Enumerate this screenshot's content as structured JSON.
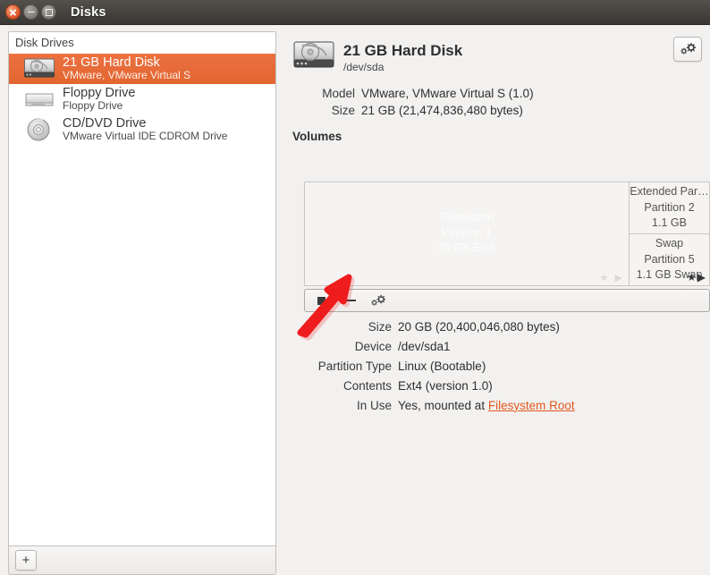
{
  "window": {
    "title": "Disks",
    "buttons": {
      "close": "close",
      "minimize": "minimize",
      "maximize": "maximize"
    }
  },
  "sidebar": {
    "header": "Disk Drives",
    "add_button_label": "+",
    "items": [
      {
        "icon": "hard-disk-icon",
        "title": "21 GB Hard Disk",
        "subtitle": "VMware, VMware Virtual S",
        "selected": true
      },
      {
        "icon": "floppy-drive-icon",
        "title": "Floppy Drive",
        "subtitle": "Floppy Drive",
        "selected": false
      },
      {
        "icon": "cdrom-drive-icon",
        "title": "CD/DVD Drive",
        "subtitle": "VMware Virtual IDE CDROM Drive",
        "selected": false
      }
    ]
  },
  "detail": {
    "disk_icon": "hard-disk-icon",
    "disk_name": "21 GB Hard Disk",
    "device_path": "/dev/sda",
    "gear_button": "gear-icon",
    "info": [
      {
        "key": "Model",
        "value": "VMware, VMware Virtual S (1.0)"
      },
      {
        "key": "Size",
        "value": "21 GB (21,474,836,480 bytes)"
      }
    ],
    "volumes_label": "Volumes",
    "volumes": {
      "main": {
        "text": "Filesystem\nPartition 1\n20 GB Ext4",
        "marks": "★ ▶"
      },
      "extended": {
        "text": "Extended Par…\nPartition 2\n1.1 GB"
      },
      "swap": {
        "text": "Swap\nPartition 5\n1.1 GB Swap",
        "marks": "★▶"
      }
    },
    "volume_toolbar": [
      {
        "name": "stop-button",
        "icon": "stop-square-icon"
      },
      {
        "name": "unmount-button",
        "icon": "minus-icon"
      },
      {
        "name": "more-actions-button",
        "icon": "gear-icon"
      }
    ],
    "partition_details": [
      {
        "key": "Size",
        "value": "20 GB (20,400,046,080 bytes)"
      },
      {
        "key": "Device",
        "value": "/dev/sda1"
      },
      {
        "key": "Partition Type",
        "value": "Linux (Bootable)"
      },
      {
        "key": "Contents",
        "value": "Ext4 (version 1.0)"
      },
      {
        "key": "In Use",
        "value": "Yes, mounted at ",
        "link": "Filesystem Root"
      }
    ]
  },
  "colors": {
    "selection_orange": "#e1662f",
    "link_orange": "#e2571e",
    "titlebar_dark": "#46433f",
    "window_bg": "#f2f1f0",
    "annotation_red": "#ee1c1c"
  },
  "annotation": {
    "type": "arrow",
    "points_to": "unmount-button"
  }
}
